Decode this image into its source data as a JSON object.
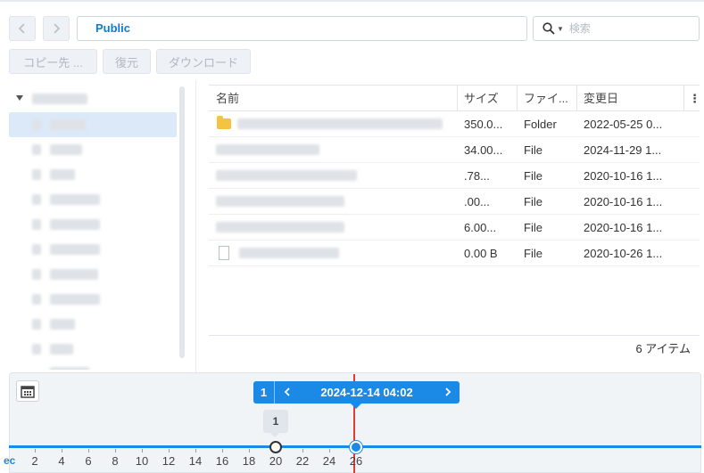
{
  "toolbar": {
    "path": "Public",
    "search_placeholder": "検索",
    "copy_label": "コピー先 ...",
    "restore_label": "復元",
    "download_label": "ダウンロード"
  },
  "columns": {
    "name": "名前",
    "size": "サイズ",
    "type": "ファイ...",
    "modified": "変更日"
  },
  "files": [
    {
      "icon": "folder-icon",
      "size": "350.0...",
      "type": "Folder",
      "modified": "2022-05-25 0..."
    },
    {
      "icon": "file-icon",
      "size": "34.00...",
      "type": "File",
      "modified": "2024-11-29 1..."
    },
    {
      "icon": "file-icon",
      "size": ".78...",
      "type": "File",
      "modified": "2020-10-16 1..."
    },
    {
      "icon": "file-icon",
      "size": ".00...",
      "type": "File",
      "modified": "2020-10-16 1..."
    },
    {
      "icon": "file-icon",
      "size": "6.00...",
      "type": "File",
      "modified": "2020-10-16 1..."
    },
    {
      "icon": "file-icon",
      "size": "0.00 B",
      "type": "File",
      "modified": "2020-10-26 1..."
    }
  ],
  "item_count": "6 アイテム",
  "timeline": {
    "count": "1",
    "datetime": "2024-12-14 04:02",
    "bubble_count": "1",
    "edge_label": "ec",
    "ticks": [
      "2",
      "4",
      "6",
      "8",
      "10",
      "12",
      "14",
      "16",
      "18",
      "20",
      "22",
      "24",
      "26"
    ],
    "accent_color": "#1a8ae6",
    "marker_color": "#e53935"
  }
}
